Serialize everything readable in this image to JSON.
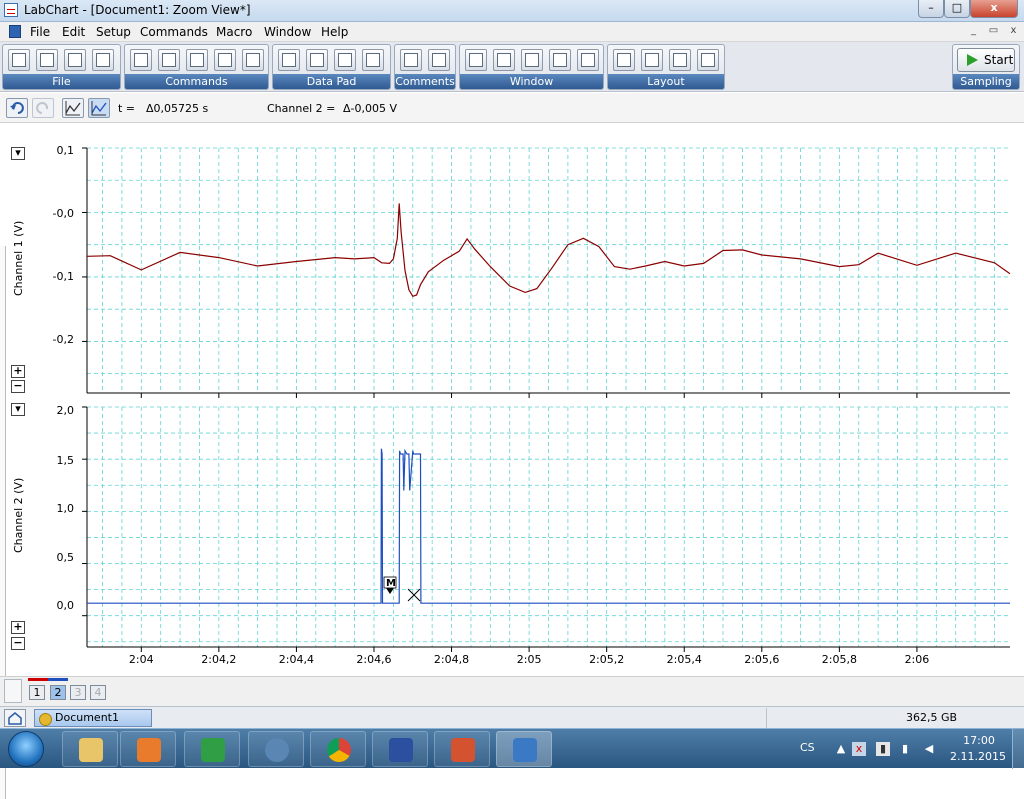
{
  "window": {
    "title": "LabChart - [Document1: Zoom View*]",
    "controls": {
      "minimize": "–",
      "maximize": "□",
      "close": "x"
    }
  },
  "menu": {
    "items": [
      "File",
      "Edit",
      "Setup",
      "Commands",
      "Macro",
      "Window",
      "Help"
    ],
    "mdi_controls": {
      "minimize": "_",
      "restore": "▭",
      "close": "x"
    }
  },
  "toolbar": {
    "groups": [
      {
        "label": "File"
      },
      {
        "label": "Commands"
      },
      {
        "label": "Data Pad"
      },
      {
        "label": "Comments"
      },
      {
        "label": "Window"
      },
      {
        "label": "Layout"
      },
      {
        "label": "Sampling"
      }
    ],
    "start_label": "Start"
  },
  "infobar": {
    "t_label": "t =",
    "t_value": "Δ0,05725 s",
    "ch_label": "Channel 2 =",
    "ch_value": "Δ-0,005 V"
  },
  "channels": [
    {
      "name": "Channel 1 (V)",
      "color": "#8b0000",
      "ticks": [
        "0,1",
        "-0,0",
        "-0,1",
        "-0,2"
      ]
    },
    {
      "name": "Channel 2 (V)",
      "color": "#1f4fbf",
      "ticks": [
        "2,0",
        "1,5",
        "1,0",
        "0,5",
        "0,0"
      ]
    }
  ],
  "time_axis": {
    "ticks": [
      "2:04",
      "2:04,2",
      "2:04,4",
      "2:04,6",
      "2:04,8",
      "2:05",
      "2:05,2",
      "2:05,4",
      "2:05,6",
      "2:05,8",
      "2:06"
    ]
  },
  "marker_label": "M",
  "pages": [
    "1",
    "2",
    "3",
    "4"
  ],
  "status": {
    "document_tab": "Document1",
    "disk_free": "362,5 GB"
  },
  "taskbar": {
    "language": "CS",
    "time": "17:00",
    "date": "2.11.2015"
  },
  "chart_data": [
    {
      "type": "line",
      "channel": "Channel 1 (V)",
      "ylabel": "Channel 1 (V)",
      "xlabel": "",
      "x_unit": "s (time of day 2:04 – 2:06)",
      "ylim": [
        -0.28,
        0.1
      ],
      "xlim": [
        123.86,
        126.24
      ],
      "grid": true,
      "series": [
        {
          "x": [
            123.86,
            123.92,
            124.0,
            124.1,
            124.2,
            124.3,
            124.4,
            124.5,
            124.55,
            124.6,
            124.62,
            124.64,
            124.65,
            124.66,
            124.665,
            124.67,
            124.68,
            124.69,
            124.7,
            124.71,
            124.72,
            124.74,
            124.78,
            124.82,
            124.84,
            124.86,
            124.9,
            124.95,
            124.99,
            125.02,
            125.06,
            125.1,
            125.14,
            125.18,
            125.22,
            125.26,
            125.3,
            125.35,
            125.4,
            125.45,
            125.5,
            125.55,
            125.6,
            125.7,
            125.8,
            125.85,
            125.9,
            126.0,
            126.1,
            126.2,
            126.24
          ],
          "values": [
            -0.068,
            -0.067,
            -0.089,
            -0.062,
            -0.07,
            -0.083,
            -0.076,
            -0.07,
            -0.072,
            -0.07,
            -0.078,
            -0.079,
            -0.072,
            -0.04,
            0.014,
            -0.03,
            -0.09,
            -0.12,
            -0.13,
            -0.128,
            -0.112,
            -0.092,
            -0.074,
            -0.06,
            -0.041,
            -0.057,
            -0.084,
            -0.114,
            -0.124,
            -0.118,
            -0.085,
            -0.05,
            -0.04,
            -0.053,
            -0.084,
            -0.088,
            -0.083,
            -0.076,
            -0.083,
            -0.079,
            -0.059,
            -0.058,
            -0.066,
            -0.072,
            -0.084,
            -0.081,
            -0.063,
            -0.082,
            -0.063,
            -0.078,
            -0.095
          ]
        }
      ]
    },
    {
      "type": "line",
      "channel": "Channel 2 (V)",
      "ylabel": "Channel 2 (V)",
      "xlabel": "",
      "x_unit": "s (time of day 2:04 – 2:06)",
      "ylim": [
        -0.3,
        2.0
      ],
      "xlim": [
        123.86,
        126.24
      ],
      "grid": true,
      "series": [
        {
          "x": [
            123.86,
            124.618,
            124.619,
            124.621,
            124.622,
            124.628,
            124.629,
            124.665,
            124.666,
            124.668,
            124.675,
            124.677,
            124.68,
            124.685,
            124.69,
            124.692,
            124.7,
            124.702,
            124.71,
            124.72,
            124.721,
            126.24
          ],
          "values": [
            0.12,
            0.12,
            1.6,
            1.55,
            0.12,
            0.12,
            0.12,
            0.12,
            1.58,
            1.55,
            1.55,
            1.2,
            1.58,
            1.55,
            1.55,
            1.2,
            1.58,
            1.55,
            1.55,
            1.55,
            0.12,
            0.12
          ]
        }
      ]
    }
  ]
}
